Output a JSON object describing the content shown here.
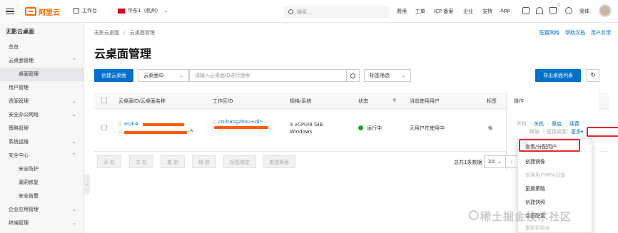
{
  "topbar": {
    "logo_text": "阿里云",
    "workbench": "工作台",
    "region": "华东1（杭州）",
    "search_placeholder": "搜索...",
    "nav": [
      "费用",
      "工单",
      "ICP 备案",
      "企业",
      "支持",
      "App"
    ],
    "cart_badge": "2",
    "lang": "简体"
  },
  "sidebar": {
    "title": "无影云桌面",
    "items": [
      {
        "label": "总览",
        "level": 1,
        "expanded": null
      },
      {
        "label": "云桌面管理",
        "level": 1,
        "expanded": true
      },
      {
        "label": "桌面管理",
        "level": 2,
        "active": true
      },
      {
        "label": "用户管理",
        "level": 1,
        "expanded": null
      },
      {
        "label": "资源管理",
        "level": 1,
        "expanded": false
      },
      {
        "label": "安全办公网络",
        "level": 1,
        "expanded": false
      },
      {
        "label": "策略管理",
        "level": 1,
        "expanded": null
      },
      {
        "label": "系统运维",
        "level": 1,
        "expanded": false
      },
      {
        "label": "安全中心",
        "level": 1,
        "expanded": true
      },
      {
        "label": "安全防护",
        "level": 2
      },
      {
        "label": "漏洞修复",
        "level": 2
      },
      {
        "label": "安全告警",
        "level": 2
      },
      {
        "label": "企业应用管理",
        "level": 1,
        "expanded": false
      },
      {
        "label": "终端管理",
        "level": 1,
        "expanded": false
      }
    ]
  },
  "main": {
    "breadcrumb": [
      "无影云桌面",
      "云桌面管理"
    ],
    "top_links": [
      "配置网络",
      "帮助文档",
      "用户反馈"
    ],
    "title": "云桌面管理",
    "create_button": "创建云桌面",
    "filter_select": "云桌面ID",
    "search_placeholder": "请输入云桌面ID进行搜索",
    "tag_filter": "标签筛选",
    "export_button": "导出桌面列表",
    "columns": [
      "云桌面ID/云桌面名称",
      "工作区ID",
      "规格/系统",
      "状态",
      "当前使用用户",
      "标签",
      "操作"
    ],
    "row": {
      "desktop_id": "ecd-4",
      "workspace_id": "cn-hangzhou+dir-",
      "spec": "4 vCPU/8 GiB",
      "os": "Windows",
      "status": "运行中",
      "status_color": "#1fa11f",
      "user": "无用户在使用中",
      "ops_row1": [
        "开机",
        "关机",
        "重启",
        "续费"
      ],
      "ops_row2": [
        "释放",
        "更换桌面",
        "更多"
      ]
    },
    "bulk_buttons": [
      "开 机",
      "关 机",
      "重 启",
      "释 放",
      "标签绑定",
      "重建桌面"
    ],
    "total_text": "总共1条数据",
    "page_size": "20",
    "current_page": "1",
    "accent": "#0070cc",
    "highlight": "#e8272b"
  },
  "more_menu": {
    "items": [
      {
        "label": "查看/分配用户",
        "disabled": false
      },
      {
        "label": "创建镜像",
        "disabled": false
      },
      {
        "label": "管理用户MFA设备",
        "disabled": true
      },
      {
        "label": "更换策略",
        "disabled": false
      },
      {
        "label": "创建快照",
        "disabled": false
      },
      {
        "label": "变更配置",
        "disabled": false
      },
      {
        "label": "重新初始化",
        "disabled": true
      }
    ]
  },
  "watermark": "稀土掘金技术社区"
}
